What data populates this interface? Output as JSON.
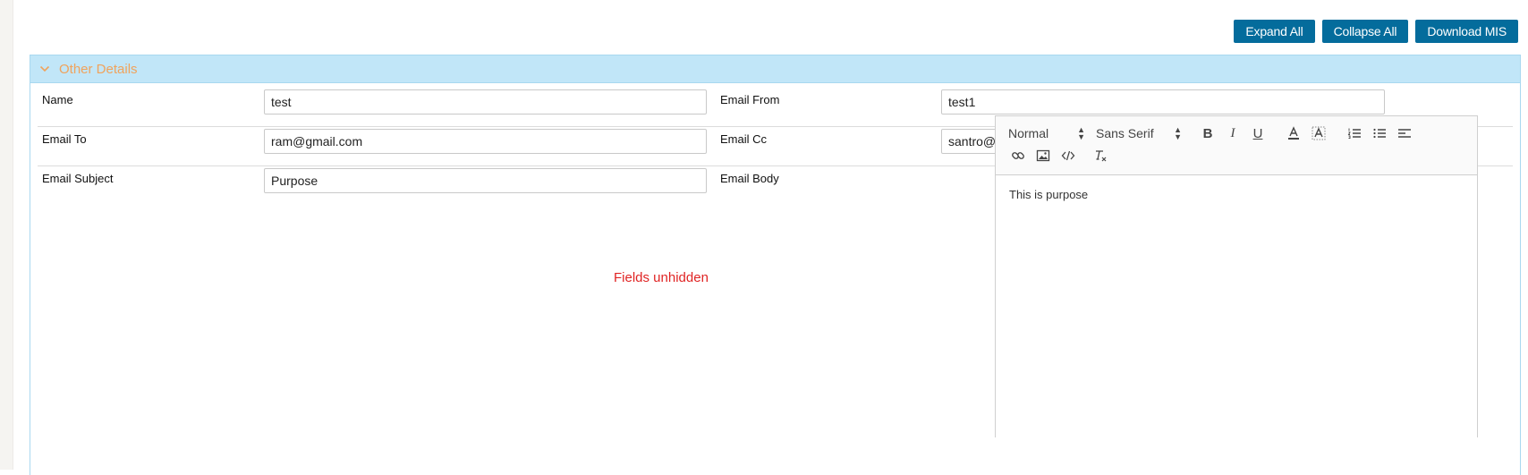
{
  "toolbar": {
    "expand_all": "Expand All",
    "collapse_all": "Collapse All",
    "download_mis": "Download MIS"
  },
  "section": {
    "title": "Other Details"
  },
  "form": {
    "name_label": "Name",
    "name_value": "test",
    "email_from_label": "Email From",
    "email_from_value": "test1",
    "email_to_label": "Email To",
    "email_to_value": "ram@gmail.com",
    "email_cc_label": "Email Cc",
    "email_cc_value": "santro@gmail.com",
    "email_subject_label": "Email Subject",
    "email_subject_value": "Purpose",
    "email_body_label": "Email Body"
  },
  "annotation": {
    "text": "Fields unhidden"
  },
  "editor": {
    "header_picker": "Normal",
    "font_picker": "Sans Serif",
    "body_text": "This is purpose",
    "icons": [
      "bold-icon",
      "italic-icon",
      "underline-icon",
      "text-color-icon",
      "background-color-icon",
      "ordered-list-icon",
      "bullet-list-icon",
      "align-icon",
      "link-icon",
      "image-icon",
      "code-icon",
      "clear-format-icon"
    ]
  },
  "colors": {
    "button_bg": "#046c9c",
    "header_bg": "#c1e6f8",
    "header_title": "#f0a35c",
    "annotation": "#e02424"
  }
}
